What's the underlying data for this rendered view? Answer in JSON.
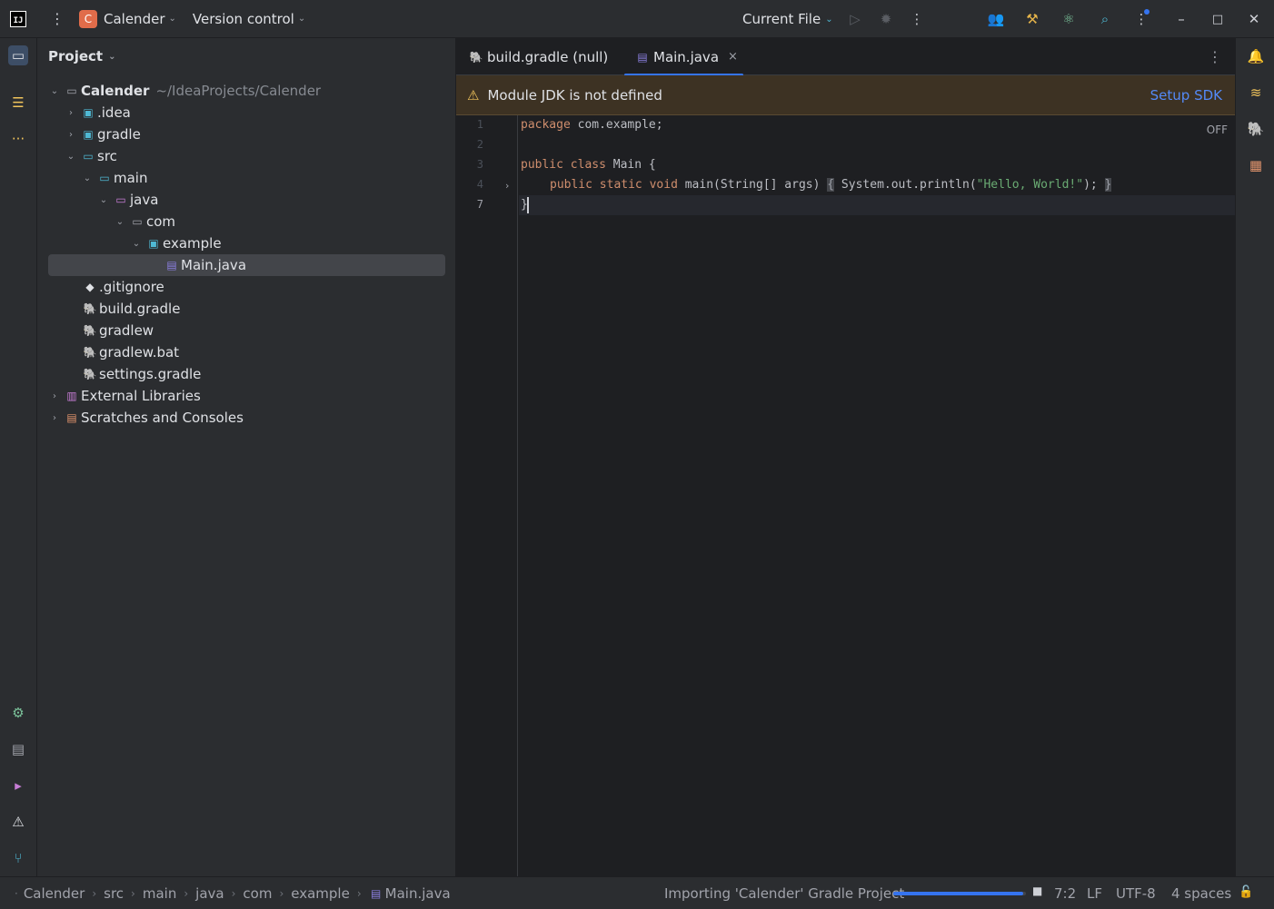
{
  "titlebar": {
    "project_badge": "C",
    "project_name": "Calender",
    "version_control": "Version control",
    "run_config": "Current File",
    "icons": [
      "app-logo-icon",
      "main-menu-icon",
      "run-icon",
      "debug-icon",
      "more-actions-icon",
      "code-with-me-icon",
      "build-tools-icon",
      "ai-assistant-icon",
      "search-icon",
      "settings-icon",
      "minimize-icon",
      "maximize-icon",
      "close-icon"
    ]
  },
  "project_panel": {
    "title": "Project",
    "tree": [
      {
        "label": "Calender",
        "hint": "~/IdeaProjects/Calender",
        "expanded": true,
        "icon": "folder-icon"
      },
      {
        "label": ".idea",
        "expanded": false,
        "icon": "idea-folder-icon"
      },
      {
        "label": "gradle",
        "expanded": false,
        "icon": "gradle-folder-icon"
      },
      {
        "label": "src",
        "expanded": true,
        "icon": "source-folder-icon"
      },
      {
        "label": "main",
        "expanded": true,
        "icon": "module-folder-icon"
      },
      {
        "label": "java",
        "expanded": true,
        "icon": "java-source-root-icon"
      },
      {
        "label": "com",
        "expanded": true,
        "icon": "package-folder-icon"
      },
      {
        "label": "example",
        "expanded": true,
        "icon": "package-icon"
      },
      {
        "label": "Main.java",
        "icon": "java-file-icon",
        "selected": true
      },
      {
        "label": ".gitignore",
        "icon": "git-file-icon"
      },
      {
        "label": "build.gradle",
        "icon": "gradle-file-icon"
      },
      {
        "label": "gradlew",
        "icon": "gradle-wrapper-icon"
      },
      {
        "label": "gradlew.bat",
        "icon": "gradle-wrapper-icon"
      },
      {
        "label": "settings.gradle",
        "icon": "gradle-file-icon"
      },
      {
        "label": "External Libraries",
        "expanded": false,
        "icon": "library-icon"
      },
      {
        "label": "Scratches and Consoles",
        "expanded": false,
        "icon": "scratches-icon"
      }
    ]
  },
  "editor": {
    "tabs": [
      {
        "label": "build.gradle (null)",
        "icon": "gradle-file-icon",
        "active": false
      },
      {
        "label": "Main.java",
        "icon": "java-file-icon",
        "active": true,
        "close": "×"
      }
    ],
    "banner": {
      "message": "Module JDK is not defined",
      "action": "Setup SDK"
    },
    "inlay_status": "OFF",
    "line_numbers": [
      "1",
      "2",
      "3",
      "4",
      "7"
    ],
    "lines": {
      "l1_kw": "package",
      "l1_rest": " com.example;",
      "l3_kw1": "public",
      "l3_kw2": "class",
      "l3_rest": " Main {",
      "l4_kw1": "public",
      "l4_kw2": "static",
      "l4_kw3": "void",
      "l4_sig": " main(String[] args) ",
      "l4_open": "{",
      "l4_body_pre": " System.out.println(",
      "l4_string": "\"Hello, World!\"",
      "l4_body_post": "); ",
      "l4_close": "}",
      "l7": "}"
    }
  },
  "statusbar": {
    "breadcrumb": [
      "Calender",
      "src",
      "main",
      "java",
      "com",
      "example",
      "Main.java"
    ],
    "task": "Importing 'Calender' Gradle Project",
    "progress": 0.98,
    "position": "7:2",
    "line_sep": "LF",
    "encoding": "UTF-8",
    "indent": "4 spaces"
  }
}
